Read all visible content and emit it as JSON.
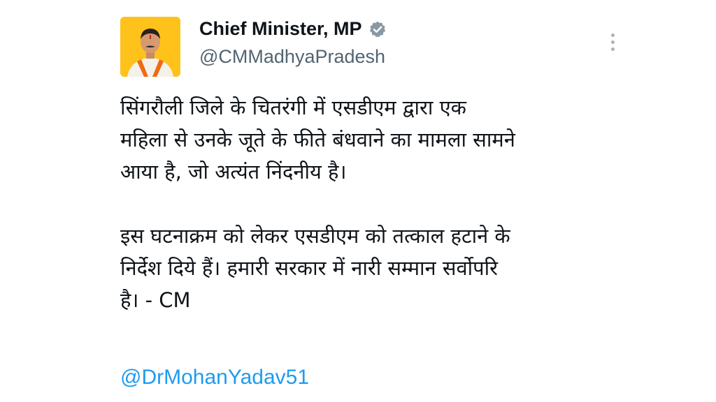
{
  "author": {
    "display_name": "Chief Minister, MP",
    "handle": "@CMMadhyaPradesh",
    "verified_icon": "verified-badge-icon",
    "verified_color": "#8a98a6"
  },
  "tweet": {
    "paragraphs": [
      {
        "lines": [
          "सिंगरौली जिले के चितरंगी में एसडीएम द्वारा एक",
          "महिला से उनके जूते के फीते बंधवाने का मामला सामने",
          "आया है, जो अत्यंत निंदनीय है।"
        ]
      },
      {
        "lines": [
          "इस घटनाक्रम को लेकर एसडीएम को तत्काल हटाने के",
          "निर्देश दिये हैं। हमारी सरकार में नारी सम्मान सर्वोपरि",
          "है। - CM"
        ]
      }
    ],
    "mention": "@DrMohanYadav51"
  },
  "colors": {
    "link": "#1d9bf0",
    "secondary_text": "#536471",
    "avatar_background": "#ffc107"
  }
}
